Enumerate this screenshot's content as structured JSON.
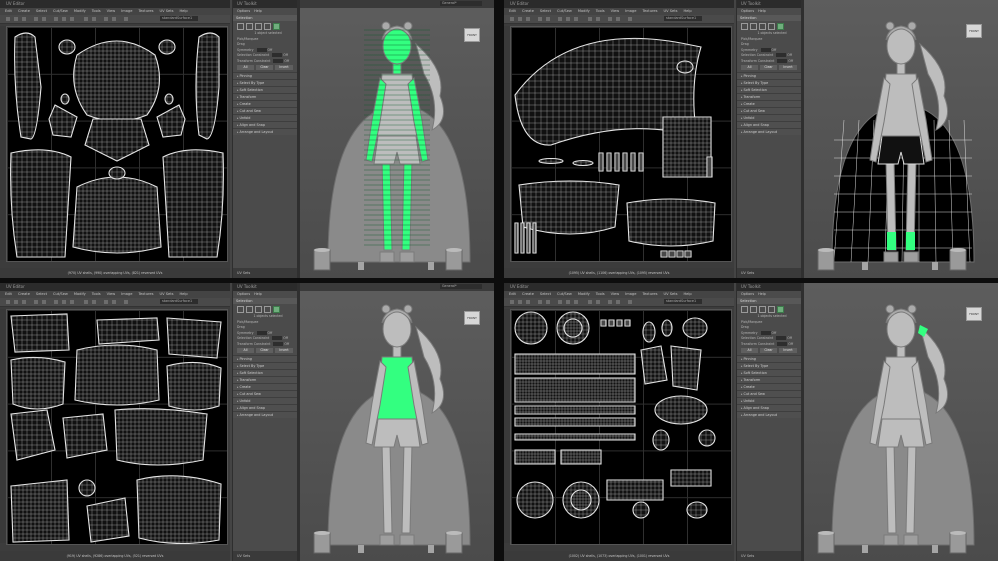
{
  "colors": {
    "selection_green": "#33ff80",
    "uv_bg": "#000000",
    "wire": "#e8e8e8",
    "panel": "#444444"
  },
  "quadrants": [
    {
      "uv_title": "UV Editor",
      "menus": [
        "Edit",
        "Create",
        "Select",
        "Cut/Sew",
        "Modify",
        "Tools",
        "View",
        "Image",
        "Textures",
        "UV Sets",
        "Help"
      ],
      "material_field": "standardSurface1",
      "status": "(970) UV shells, (990) overlapping UVs, (821) reversed UVs",
      "toolkit": {
        "title": "UV Toolkit",
        "menus": [
          "Options",
          "Help"
        ],
        "selection": "Selection",
        "selected_count": "1 object selected",
        "pick_marquee": "Pick/Marquee",
        "drag": "Drag",
        "symmetry": "Symmetry",
        "off": "Off",
        "selection_constraint": "Selection Constraint",
        "transform_constraint": "Transform Constraint",
        "btn_all": "All",
        "btn_clear": "Clear",
        "btn_invert": "Invert",
        "sections": [
          "Pinning",
          "Select By Type",
          "Soft Selection",
          "Transform",
          "Create",
          "Cut and Sew",
          "Unfold",
          "Align and Snap",
          "Arrange and Layout"
        ],
        "uv_sets": "UV Sets"
      },
      "viewport": {
        "label": "Workspace:",
        "field": "General*",
        "cam": "FRONT"
      },
      "highlight": "head-arms-legs"
    },
    {
      "uv_title": "UV Editor",
      "menus": [
        "Edit",
        "Create",
        "Select",
        "Cut/Sew",
        "Modify",
        "Tools",
        "View",
        "Image",
        "Textures",
        "UV Sets",
        "Help"
      ],
      "material_field": "standardSurface1",
      "status": "(1095) UV shells, (1106) overlapping UVs, (1095) reversed UVs",
      "toolkit": {
        "title": "UV Toolkit",
        "menus": [
          "Options",
          "Help"
        ],
        "selection": "Selection",
        "selected_count": "1 objects selected",
        "pick_marquee": "Pick/Marquee",
        "drag": "Drag",
        "symmetry": "Symmetry",
        "off": "Off",
        "selection_constraint": "Selection Constraint",
        "transform_constraint": "Transform Constraint",
        "btn_all": "All",
        "btn_clear": "Clear",
        "btn_invert": "Invert",
        "sections": [
          "Pinning",
          "Select By Type",
          "Soft Selection",
          "Transform",
          "Create",
          "Cut and Sew",
          "Unfold",
          "Align and Snap",
          "Arrange and Layout"
        ],
        "uv_sets": "UV Sets"
      },
      "viewport": {
        "label": "Workspace:",
        "field": "General*",
        "cam": "FRONT"
      },
      "highlight": "shorts-socks"
    },
    {
      "uv_title": "UV Editor",
      "menus": [
        "Edit",
        "Create",
        "Select",
        "Cut/Sew",
        "Modify",
        "Tools",
        "View",
        "Image",
        "Textures",
        "UV Sets",
        "Help"
      ],
      "material_field": "standardSurface1",
      "status": "(919) UV shells, (9286) overlapping UVs, (521) reversed UVs",
      "toolkit": {
        "title": "UV Toolkit",
        "menus": [
          "Options",
          "Help"
        ],
        "selection": "Selection",
        "selected_count": "1 objects selected",
        "pick_marquee": "Pick/Marquee",
        "drag": "Drag",
        "symmetry": "Symmetry",
        "off": "Off",
        "selection_constraint": "Selection Constraint",
        "transform_constraint": "Transform Constraint",
        "btn_all": "All",
        "btn_clear": "Clear",
        "btn_invert": "Invert",
        "sections": [
          "Pinning",
          "Select By Type",
          "Soft Selection",
          "Transform",
          "Create",
          "Cut and Sew",
          "Unfold",
          "Align and Snap",
          "Arrange and Layout"
        ],
        "uv_sets": "UV Sets"
      },
      "viewport": {
        "label": "Workspace:",
        "field": "General*",
        "cam": "FRONT"
      },
      "highlight": "top"
    },
    {
      "uv_title": "UV Editor",
      "menus": [
        "Edit",
        "Create",
        "Select",
        "Cut/Sew",
        "Modify",
        "Tools",
        "View",
        "Image",
        "Textures",
        "UV Sets",
        "Help"
      ],
      "material_field": "standardSurface1",
      "status": "(1002) UV shells, (1073) overlapping UVs, (1001) reversed UVs",
      "toolkit": {
        "title": "UV Toolkit",
        "menus": [
          "Options",
          "Help"
        ],
        "selection": "Selection",
        "selected_count": "1 objects selected",
        "pick_marquee": "Pick/Marquee",
        "drag": "Drag",
        "symmetry": "Symmetry",
        "off": "Off",
        "selection_constraint": "Selection Constraint",
        "transform_constraint": "Transform Constraint",
        "btn_all": "All",
        "btn_clear": "Clear",
        "btn_invert": "Invert",
        "sections": [
          "Pinning",
          "Select By Type",
          "Soft Selection",
          "Transform",
          "Create",
          "Cut and Sew",
          "Unfold",
          "Align and Snap",
          "Arrange and Layout"
        ],
        "uv_sets": "UV Sets"
      },
      "viewport": {
        "label": "Workspace:",
        "field": "General*",
        "cam": "FRONT"
      },
      "highlight": "hair-accessory"
    }
  ]
}
